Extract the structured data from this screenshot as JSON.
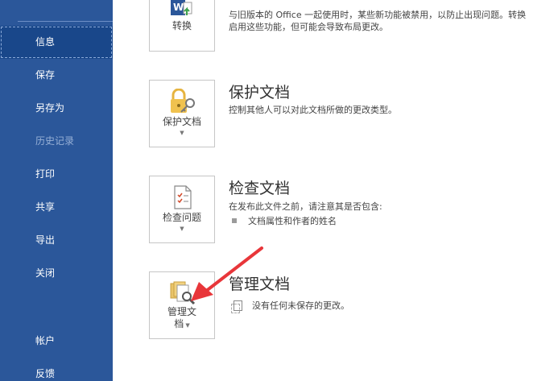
{
  "sidebar": {
    "items": [
      {
        "label": "信息",
        "active": true
      },
      {
        "label": "保存"
      },
      {
        "label": "另存为"
      },
      {
        "label": "历史记录",
        "disabled": true
      },
      {
        "label": "打印"
      },
      {
        "label": "共享"
      },
      {
        "label": "导出"
      },
      {
        "label": "关闭"
      }
    ],
    "bottom_items": [
      {
        "label": "帐户"
      },
      {
        "label": "反馈"
      }
    ]
  },
  "convert": {
    "button_label": "转换",
    "desc_line1": "与旧版本的 Office 一起使用时，某些新功能被禁用，以防止出现问题。转换",
    "desc_line2": "启用这些功能，但可能会导致布局更改。"
  },
  "protect": {
    "title": "保护文档",
    "button_label": "保护文档",
    "desc": "控制其他人可以对此文档所做的更改类型。"
  },
  "inspect": {
    "title": "检查文档",
    "button_label": "检查问题",
    "desc": "在发布此文件之前，请注意其是否包含:",
    "bullet": "文档属性和作者的姓名"
  },
  "manage": {
    "title": "管理文档",
    "button_label_line1": "管理文",
    "button_label_line2": "档",
    "desc": "没有任何未保存的更改。"
  },
  "colors": {
    "sidebar_bg": "#2b579a",
    "sidebar_active": "#19478a",
    "arrow": "#e8363a"
  },
  "icons": {
    "convert": "word-convert-icon",
    "protect": "lock-key-icon",
    "inspect": "inspect-checklist-icon",
    "manage": "manage-versions-magnifier-icon"
  }
}
